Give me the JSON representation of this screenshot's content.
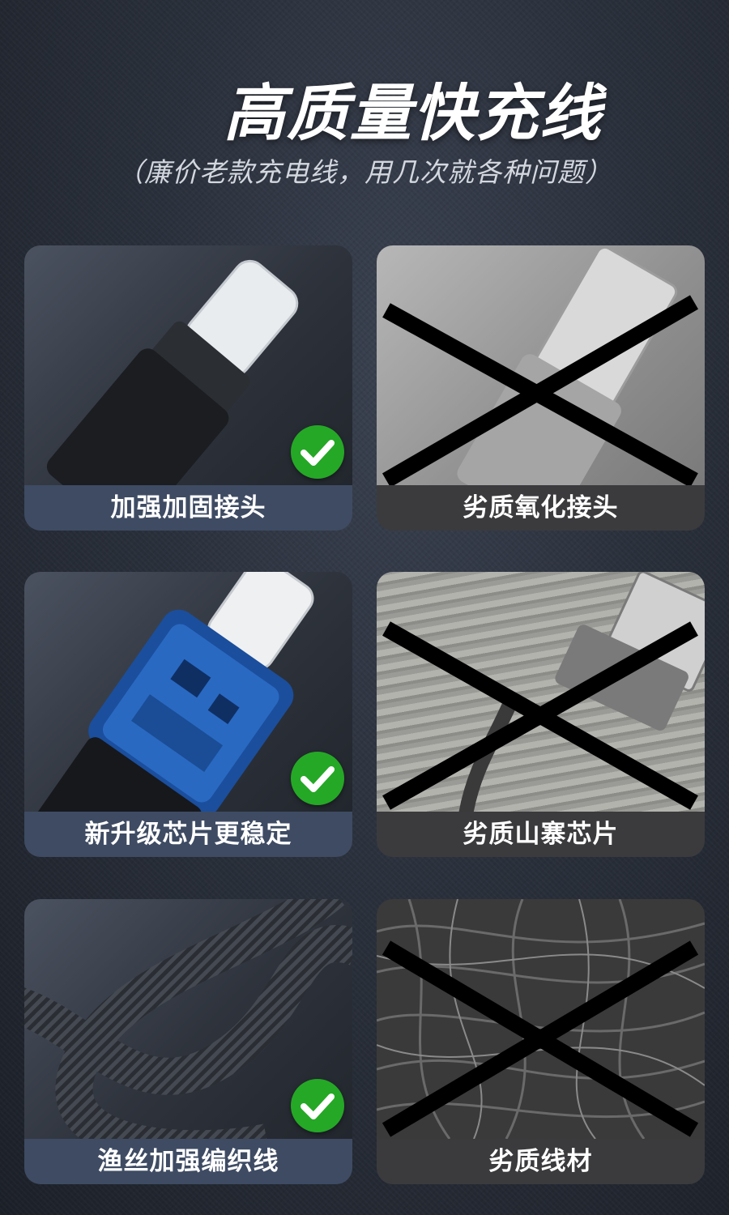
{
  "header": {
    "title": "高质量快充线",
    "title_prefix": "(",
    "subtitle": "（廉价老款充电线，用几次就各种问题）"
  },
  "comparisons": [
    {
      "good": "加强加固接头",
      "bad": "劣质氧化接头"
    },
    {
      "good": "新升级芯片更稳定",
      "bad": "劣质山寨芯片"
    },
    {
      "good": "渔丝加强编织线",
      "bad": "劣质线材"
    }
  ],
  "colors": {
    "good_caption_bg": "#3e4b63",
    "bad_caption_bg": "#3b3b3e",
    "check_green": "#25a826",
    "cross_black": "#000000"
  }
}
